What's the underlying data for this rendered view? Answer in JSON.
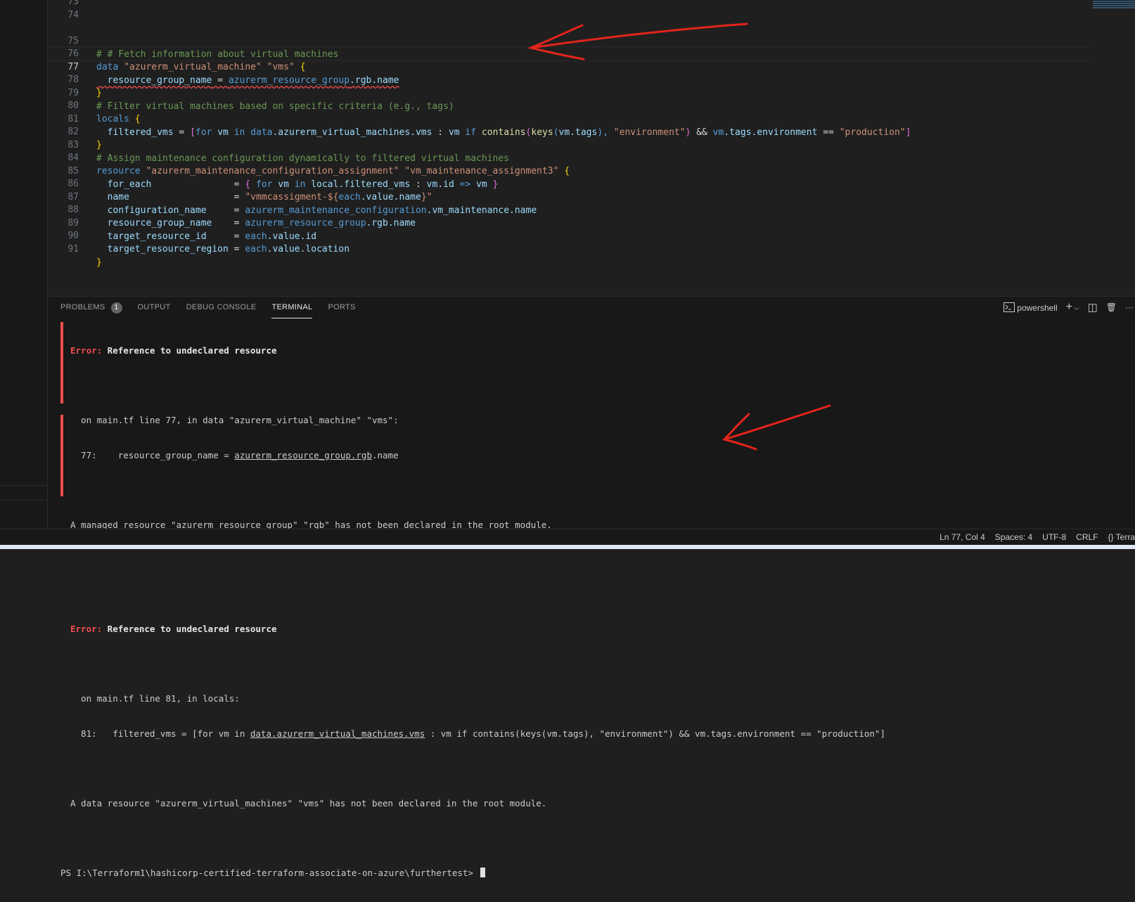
{
  "editor": {
    "lines": [
      {
        "n": "73"
      },
      {
        "n": "74"
      },
      {
        "n": "75"
      },
      {
        "n": "76"
      },
      {
        "n": "77"
      },
      {
        "n": "78"
      },
      {
        "n": "79"
      },
      {
        "n": "80"
      },
      {
        "n": "81"
      },
      {
        "n": "82"
      },
      {
        "n": "83"
      },
      {
        "n": "84"
      },
      {
        "n": "85"
      },
      {
        "n": "86"
      },
      {
        "n": "87"
      },
      {
        "n": "88"
      },
      {
        "n": "89"
      },
      {
        "n": "90"
      },
      {
        "n": "91"
      }
    ],
    "tokens": {
      "l75_comment": "# # Fetch information about virtual machines",
      "l76_kw": "data",
      "l76_s1": "\"azurerm_virtual_machine\"",
      "l76_s2": "\"vms\"",
      "l76_br": "{",
      "l77_attr": "  resource_group_name",
      "l77_eq": " = ",
      "l77_ref": "azurerm_resource_group",
      "l77_rest": ".rgb.name",
      "l78_br": "}",
      "l79_comment": "# Filter virtual machines based on specific criteria (e.g., tags)",
      "l80_kw": "locals",
      "l80_br": "{",
      "l81_attr": "  filtered_vms",
      "l81_eq": " = ",
      "l81_a": "[",
      "l81_for": "for",
      "l81_vm": " vm ",
      "l81_in": "in",
      "l81_ref": " data",
      "l81_ref2": ".azurerm_virtual_machines.vms",
      "l81_colon": " : ",
      "l81_vm2": "vm",
      "l81_if": " if ",
      "l81_fn": "contains",
      "l81_p1": "(",
      "l81_fn2": "keys",
      "l81_p2": "(",
      "l81_vmtags": "vm.tags",
      "l81_p3": "), ",
      "l81_s1": "\"environment\"",
      "l81_p4": ") ",
      "l81_and": "&&",
      "l81_vm3": " vm",
      "l81_rest": ".tags.environment",
      "l81_eqeq": " == ",
      "l81_s2": "\"production\"",
      "l81_z": "]",
      "l82_br": "}",
      "l83_comment": "# Assign maintenance configuration dynamically to filtered virtual machines",
      "l84_kw": "resource",
      "l84_s1": "\"azurerm_maintenance_configuration_assignment\"",
      "l84_s2": "\"vm_maintenance_assignment3\"",
      "l84_br": "{",
      "l85_attr": "  for_each",
      "l85_pad": "               = ",
      "l85_b1": "{ ",
      "l85_for": "for",
      "l85_vm": " vm ",
      "l85_in": "in",
      "l85_ref": " local.filtered_vms",
      "l85_colon": " : ",
      "l85_vmid": "vm.id",
      "l85_arrow": " => ",
      "l85_vm2": "vm",
      "l85_b2": " }",
      "l86_attr": "  name",
      "l86_pad": "                   = ",
      "l86_s": "\"vmmcassigment-${",
      "l86_each": "each",
      "l86_rest": ".value.name",
      "l86_s2": "}\"",
      "l87_attr": "  configuration_name",
      "l87_pad": "     = ",
      "l87_ref": "azurerm_maintenance_configuration",
      "l87_rest": ".vm_maintenance.name",
      "l88_attr": "  resource_group_name",
      "l88_pad": "    = ",
      "l88_ref": "azurerm_resource_group",
      "l88_rest": ".rgb.name",
      "l89_attr": "  target_resource_id",
      "l89_pad": "     = ",
      "l89_each": "each",
      "l89_rest": ".value.id",
      "l90_attr": "  target_resource_region",
      "l90_pad": " = ",
      "l90_each": "each",
      "l90_rest": ".value.location",
      "l91_br": "}"
    }
  },
  "panel": {
    "tabs": [
      {
        "label": "PROBLEMS"
      },
      {
        "label": "OUTPUT"
      },
      {
        "label": "DEBUG CONSOLE"
      },
      {
        "label": "TERMINAL"
      },
      {
        "label": "PORTS"
      }
    ],
    "problems_count": "1",
    "shell_label": "powershell",
    "add_label": "+",
    "chevron": "⌵",
    "split_icon": "◫",
    "trash_icon": "🗑",
    "more_icon": "···"
  },
  "terminal": {
    "e1_label": "Error:",
    "e1_title": " Reference to undeclared resource",
    "e1_loc": "  on main.tf line 77, in data \"azurerm_virtual_machine\" \"vms\":",
    "e1_code_pre": "  77:    resource_group_name = ",
    "e1_code_ul": "azurerm_resource_group.rgb",
    "e1_code_post": ".name",
    "e1_msg": "A managed resource \"azurerm_resource_group\" \"rgb\" has not been declared in the root module.",
    "e2_label": "Error:",
    "e2_title": " Reference to undeclared resource",
    "e2_loc": "  on main.tf line 81, in locals:",
    "e2_code_pre": "  81:   filtered_vms = [for vm in ",
    "e2_code_ul": "data.azurerm_virtual_machines.vms",
    "e2_code_post": " : vm if contains(keys(vm.tags), \"environment\") && vm.tags.environment == \"production\"]",
    "e2_msg": "A data resource \"azurerm_virtual_machines\" \"vms\" has not been declared in the root module.",
    "prompt": "PS I:\\Terraform1\\hashicorp-certified-terraform-associate-on-azure\\furthertest> "
  },
  "statusbar": {
    "position": "Ln 77, Col 4",
    "spaces": "Spaces: 4",
    "encoding": "UTF-8",
    "eol": "CRLF",
    "lang": "{} Terra"
  },
  "colors": {
    "annotation_arrow": "#e3241b",
    "error": "#f14c4c"
  }
}
